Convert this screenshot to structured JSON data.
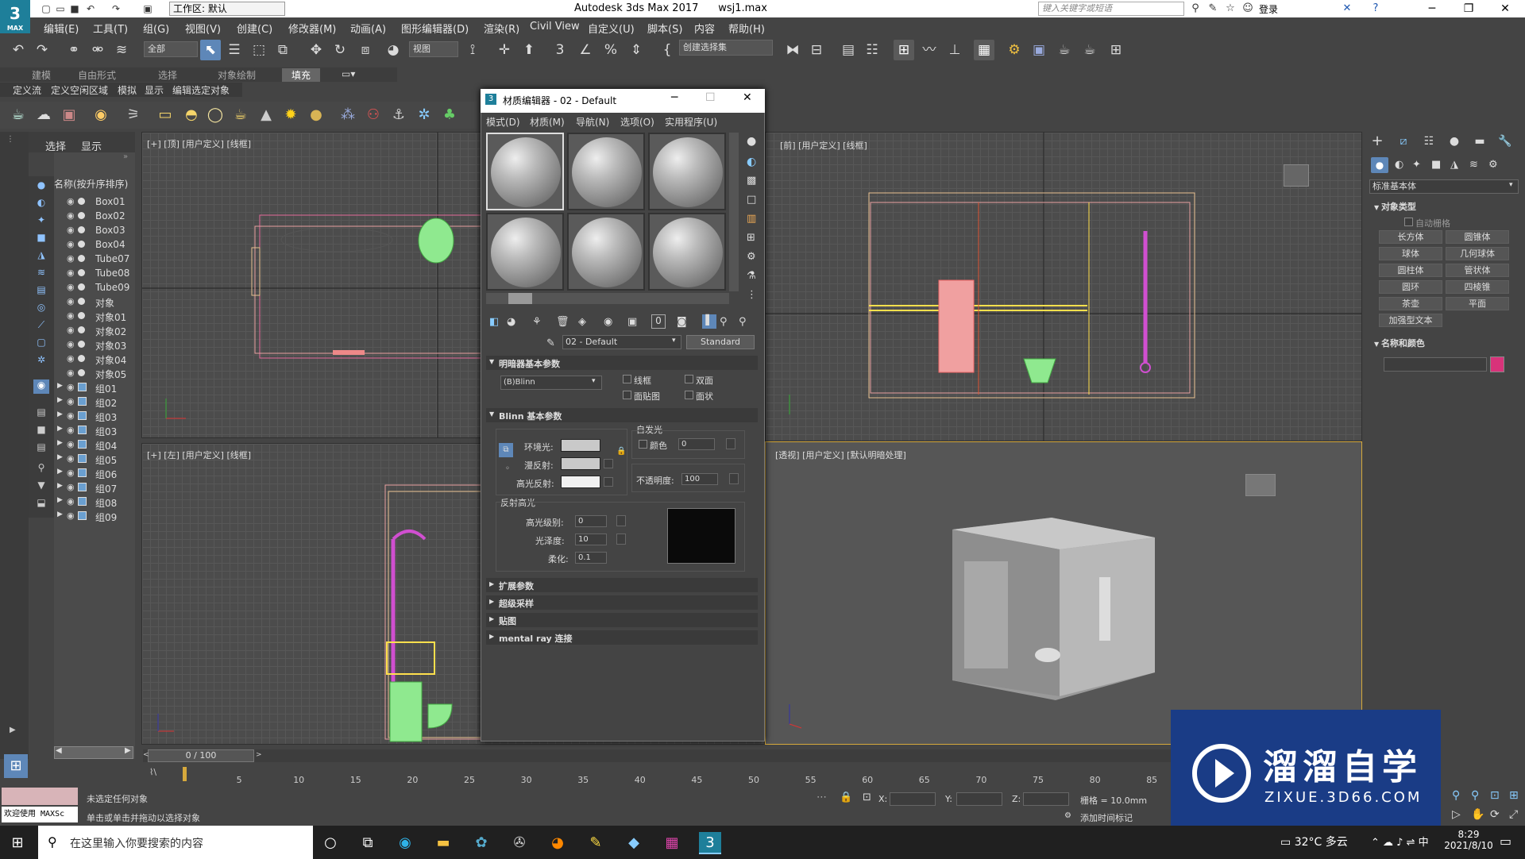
{
  "app": {
    "logo_text": "3",
    "logo_sub": "MAX",
    "workspace": "工作区: 默认",
    "title": "Autodesk 3ds Max 2017",
    "filename": "wsj1.max",
    "search_placeholder": "键入关键字或短语",
    "login": "登录"
  },
  "menu": [
    "编辑(E)",
    "工具(T)",
    "组(G)",
    "视图(V)",
    "创建(C)",
    "修改器(M)",
    "动画(A)",
    "图形编辑器(D)",
    "渲染(R)",
    "Civil View",
    "自定义(U)",
    "脚本(S)",
    "内容",
    "帮助(H)"
  ],
  "toolbar": {
    "filter": "全部",
    "coord": "视图",
    "selection_set": "创建选择集"
  },
  "ribbon": {
    "tabs": [
      "建模",
      "自由形式",
      "选择",
      "对象绘制",
      "填充"
    ],
    "active_tab": "填充",
    "sub": [
      "定义流",
      "定义空闲区域",
      "模拟",
      "显示",
      "编辑选定对象"
    ]
  },
  "scene": {
    "tabs": [
      "选择",
      "显示"
    ],
    "column": "名称(按升序排序)",
    "objects": [
      "Box01",
      "Box02",
      "Box03",
      "Box04",
      "Tube07",
      "Tube08",
      "Tube09",
      "对象",
      "对象01",
      "对象02",
      "对象03",
      "对象04",
      "对象05"
    ],
    "groups": [
      "组01",
      "组02",
      "组03",
      "组03",
      "组04",
      "组05",
      "组06",
      "组07",
      "组08",
      "组09"
    ]
  },
  "viewports": {
    "top": "[+] [顶] [用户定义] [线框]",
    "front": "[前] [用户定义] [线框]",
    "left": "[+] [左] [用户定义] [线框]",
    "persp": "[透视] [用户定义] [默认明暗处理]"
  },
  "mat_editor": {
    "title": "材质编辑器 - 02 - Default",
    "menus": [
      "模式(D)",
      "材质(M)",
      "导航(N)",
      "选项(O)",
      "实用程序(U)"
    ],
    "material_name": "02 - Default",
    "material_type": "Standard",
    "shader_section": "明暗器基本参数",
    "shader": "(B)Blinn",
    "opt_wire": "线框",
    "opt_2side": "双面",
    "opt_facemap": "面贴图",
    "opt_faceted": "面状",
    "blinn_section": "Blinn 基本参数",
    "self_illum": "自发光",
    "color": "颜色",
    "self_illum_val": "0",
    "ambient": "环境光:",
    "diffuse": "漫反射:",
    "specular": "高光反射:",
    "opacity": "不透明度:",
    "opacity_val": "100",
    "spec_highlights": "反射高光",
    "spec_level": "高光级别:",
    "spec_level_val": "0",
    "gloss": "光泽度:",
    "gloss_val": "10",
    "soften": "柔化:",
    "soften_val": "0.1",
    "rollouts": [
      "扩展参数",
      "超级采样",
      "贴图",
      "mental ray 连接"
    ]
  },
  "command_panel": {
    "category": "标准基本体",
    "object_type": "对象类型",
    "autogrid": "自动栅格",
    "buttons": [
      "长方体",
      "圆锥体",
      "球体",
      "几何球体",
      "圆柱体",
      "管状体",
      "圆环",
      "四棱锥",
      "茶壶",
      "平面",
      "加强型文本"
    ],
    "name_color": "名称和颜色",
    "obj_color": "#d8337a"
  },
  "timeline": {
    "frame": "0 / 100",
    "ticks": [
      "5",
      "10",
      "15",
      "20",
      "25",
      "30",
      "35",
      "40",
      "45",
      "50",
      "55",
      "60",
      "65",
      "70",
      "75",
      "80",
      "85"
    ]
  },
  "status": {
    "welcome": "欢迎使用 MAXSc",
    "no_select": "未选定任何对象",
    "hint": "单击或单击并拖动以选择对象",
    "x": "X:",
    "y": "Y:",
    "z": "Z:",
    "grid": "栅格 = 10.0mm",
    "add_tag": "添加时间标记"
  },
  "taskbar": {
    "search": "在这里输入你要搜索的内容",
    "weather": "32°C 多云",
    "ime": "中",
    "time": "8:29",
    "date": "2021/8/10"
  },
  "watermark": {
    "cn": "溜溜自学",
    "url": "ZIXUE.3D66.COM"
  }
}
